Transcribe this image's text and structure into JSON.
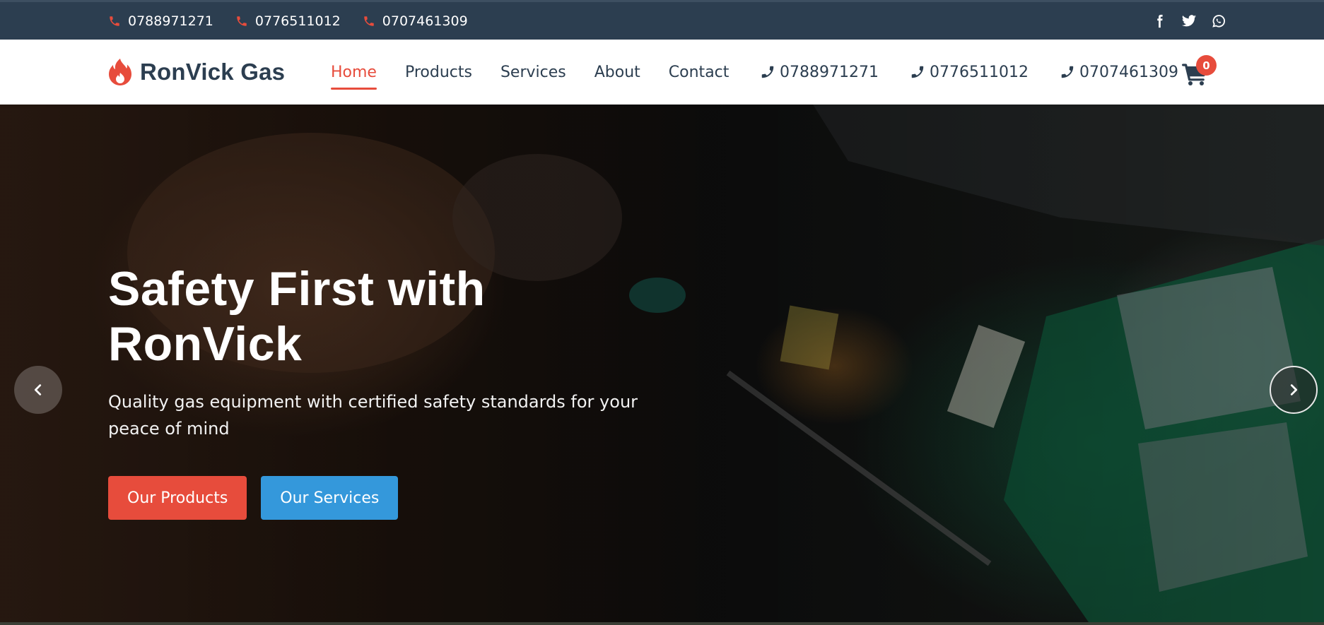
{
  "topbar": {
    "phones": [
      "0788971271",
      "0776511012",
      "0707461309"
    ],
    "phone_icon": "phone-icon",
    "socials": [
      "facebook-icon",
      "twitter-icon",
      "whatsapp-icon"
    ],
    "background": "#2c3e50"
  },
  "header": {
    "brand": {
      "name": "RonVick Gas",
      "icon": "flame-icon"
    },
    "nav": [
      {
        "label": "Home",
        "active": true
      },
      {
        "label": "Products",
        "active": false
      },
      {
        "label": "Services",
        "active": false
      },
      {
        "label": "About",
        "active": false
      },
      {
        "label": "Contact",
        "active": false
      }
    ],
    "phones": [
      "0788971271",
      "0776511012",
      "0707461309"
    ],
    "cart": {
      "count": "0",
      "icon": "cart-icon"
    }
  },
  "hero": {
    "title": "Safety First with RonVick",
    "subtitle": "Quality gas equipment with certified safety standards for your peace of mind",
    "primary_button": "Our Products",
    "secondary_button": "Our Services",
    "prev_icon": "chevron-left-icon",
    "next_icon": "chevron-right-icon"
  },
  "colors": {
    "accent": "#e74c3c",
    "secondary": "#3498db",
    "brand_dark": "#2c3e50"
  }
}
